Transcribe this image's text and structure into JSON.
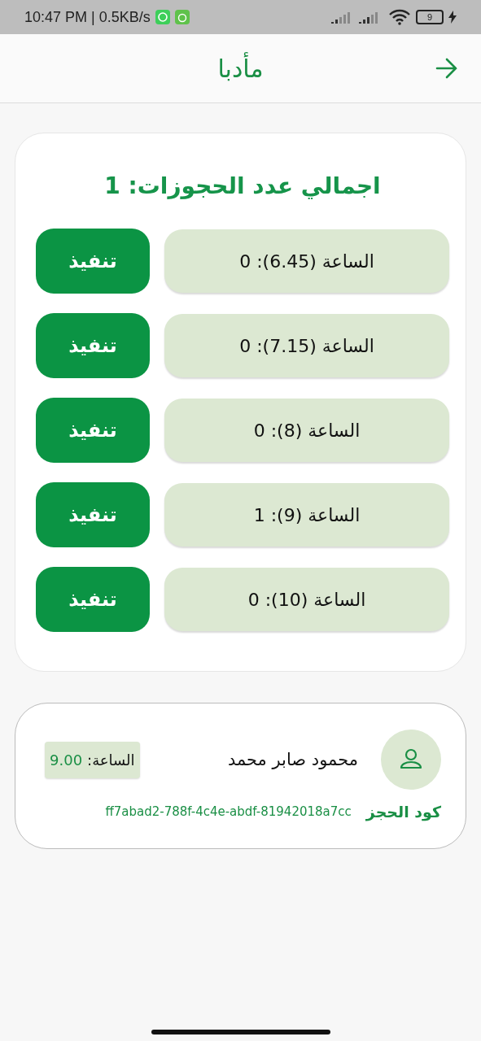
{
  "status_bar": {
    "time": "10:47 PM | 0.5KB/s",
    "battery": "9"
  },
  "header": {
    "title": "مأدبا"
  },
  "summary": {
    "title": "اجمالي عدد الحجوزات: 1",
    "slots": [
      {
        "label": "الساعة (6.45): 0",
        "action": "تنفيذ"
      },
      {
        "label": "الساعة (7.15): 0",
        "action": "تنفيذ"
      },
      {
        "label": "الساعة (8): 0",
        "action": "تنفيذ"
      },
      {
        "label": "الساعة (9): 1",
        "action": "تنفيذ"
      },
      {
        "label": "الساعة (10): 0",
        "action": "تنفيذ"
      }
    ]
  },
  "bookings": [
    {
      "name": "محمود صابر محمد",
      "time_label": "الساعة:",
      "time_value": "9.00",
      "code_label": "كود الحجز",
      "code": "ff7abad2-788f-4c4e-abdf-81942018a7cc"
    }
  ]
}
